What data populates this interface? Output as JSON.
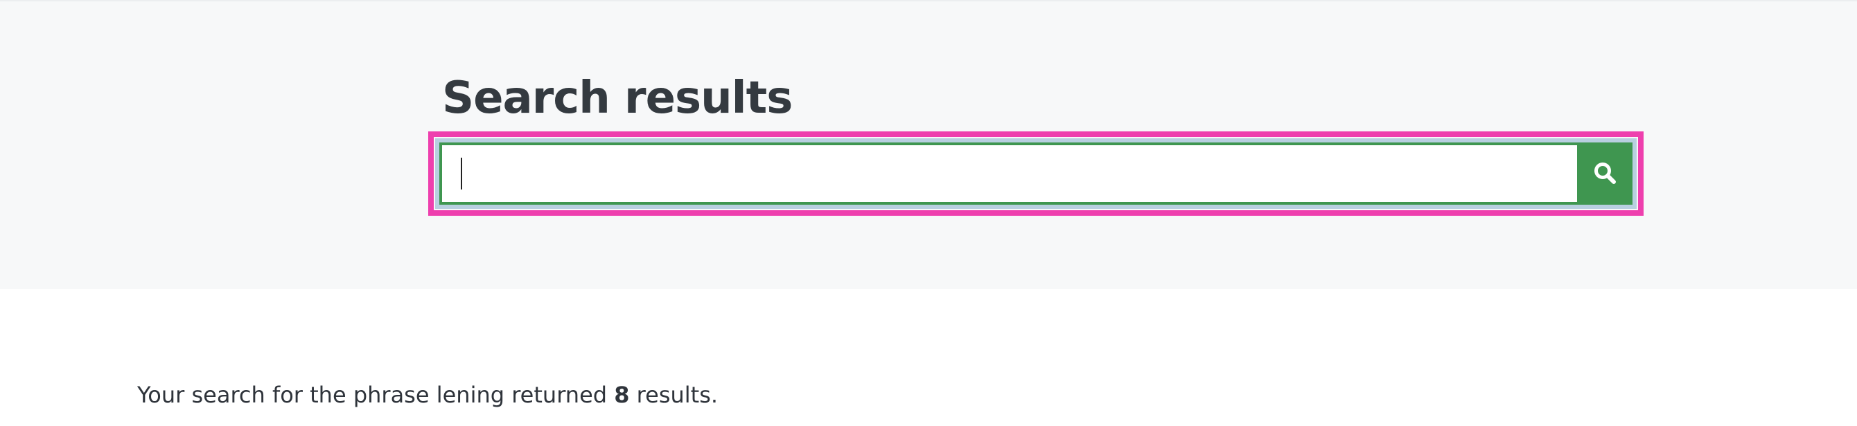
{
  "header": {
    "title": "Search results"
  },
  "search": {
    "value": "",
    "placeholder": "",
    "button_icon": "search-icon",
    "colors": {
      "accent": "#3f9650",
      "highlight": "#ee3fae",
      "focus_ring": "#b8cfe0"
    }
  },
  "results": {
    "prefix": "Your search for the phrase lening returned ",
    "count": "8",
    "suffix": " results."
  }
}
